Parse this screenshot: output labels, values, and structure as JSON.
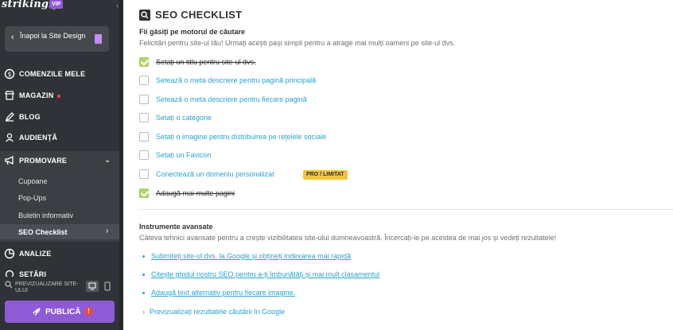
{
  "sidebar": {
    "logo": "strikingly",
    "vip": "VIP",
    "back_label": "Înapoi la Site Design",
    "nav": {
      "orders": "COMENZILE MELE",
      "store": "MAGAZIN",
      "blog": "BLOG",
      "audience": "AUDIENȚĂ",
      "promote": "PROMOVARE",
      "analytics": "ANALIZE",
      "settings": "SETĂRI"
    },
    "submenu": [
      "Cupoane",
      "Pop-Ups",
      "Buletin informativ",
      "SEO Checklist"
    ],
    "preview_label": "PREVIZUALIZARE SITE-ULUI",
    "publish_label": "PUBLICĂ",
    "publish_alert": "!"
  },
  "main": {
    "title": "SEO CHECKLIST",
    "search_section": {
      "heading": "Fii găsiți pe motorul de căutare",
      "description": "Felicitări pentru site-ul tău! Urmați acești pași simpli pentru a atrage mai mulți oameni pe site-ul dvs.",
      "items": [
        {
          "label": "Setați un titlu pentru site-ul dvs.",
          "done": true
        },
        {
          "label": "Setează o meta descriere pentru pagină principală",
          "done": false
        },
        {
          "label": "Setează o meta descriere pentru fiecare pagină",
          "done": false
        },
        {
          "label": "Setați o categorie",
          "done": false
        },
        {
          "label": "Setați o imagine pentru distribuirea pe rețelele sociale",
          "done": false
        },
        {
          "label": "Setați un Favicon",
          "done": false
        },
        {
          "label": "Conectează un domeniu personalizat",
          "done": false,
          "badge": "PRO / LIMITAT"
        },
        {
          "label": "Adaugă mai multe pagini",
          "done": true
        }
      ]
    },
    "advanced_section": {
      "heading": "Instrumente avansate",
      "description": "Câteva tehnici avansate pentru a crește vizibilitatea site-ului dumneavoastră. Încercați-le pe acestea de mai jos și vedeți rezultatele!",
      "links": [
        "Submiteți site-ul dvs. la Google și obțineți indexarea mai rapidă",
        "Citește ghidul nostru SEO pentru a-ți îmbunătăți și mai mult clasamentul",
        "Adaugă text alternativ pentru fiecare imagine."
      ],
      "preview_link": "Previzualizați rezultatele căutării în Google"
    }
  },
  "colors": {
    "sidebar_bg": "#2f3236",
    "accent_purple": "#8e5ad6",
    "link_blue": "#2aa3cf",
    "check_green": "#b3d66a",
    "badge_yellow": "#f2c43c",
    "alert_red": "#e84a4a"
  }
}
